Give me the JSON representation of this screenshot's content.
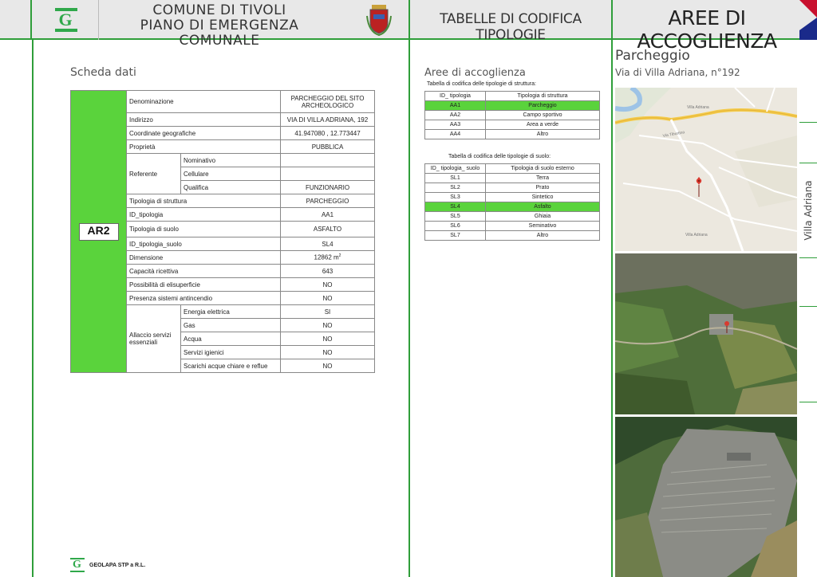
{
  "header": {
    "title_line1": "Comune di Tivoli",
    "title_line2": "Piano di Emergenza Comunale",
    "tab": "Tabelle di codifica tipologie",
    "section": "AREE DI ACCOGLIENZA"
  },
  "left": {
    "sheet_title": "Scheda dati",
    "code": "AR2",
    "rows": {
      "denominazione_label": "Denominazione",
      "denominazione_value": "PARCHEGGIO DEL SITO ARCHEOLOGICO",
      "indirizzo_label": "Indirizzo",
      "indirizzo_value": "VIA DI VILLA ADRIANA, 192",
      "coord_label": "Coordinate geografiche",
      "coord_value": "41.947080 , 12.773447",
      "proprieta_label": "Proprietà",
      "proprieta_value": "PUBBLICA",
      "referente_label": "Referente",
      "nominativo_label": "Nominativo",
      "nominativo_value": "",
      "cellulare_label": "Cellulare",
      "cellulare_value": "",
      "qualifica_label": "Qualifica",
      "qualifica_value": "FUNZIONARIO",
      "tip_strutt_label": "Tipologia di struttura",
      "tip_strutt_value": "PARCHEGGIO",
      "id_tip_label": "ID_tipologia",
      "id_tip_value": "AA1",
      "tip_suolo_label": "Tipologia di suolo",
      "tip_suolo_value": "ASFALTO",
      "id_tip_suolo_label": "ID_tipologia_suolo",
      "id_tip_suolo_value": "SL4",
      "dimensione_label": "Dimensione",
      "dimensione_value": "12862 m",
      "dimensione_unit_sup": "2",
      "capacita_label": "Capacità ricettiva",
      "capacita_value": "643",
      "elisuperficie_label": "Possibilità di elisuperficie",
      "elisuperficie_value": "NO",
      "antincendio_label": "Presenza sistemi antincendio",
      "antincendio_value": "NO",
      "allaccio_label": "Allaccio servizi essenziali",
      "energia_label": "Energia elettrica",
      "energia_value": "SI",
      "gas_label": "Gas",
      "gas_value": "NO",
      "acqua_label": "Acqua",
      "acqua_value": "NO",
      "igienici_label": "Servizi igienici",
      "igienici_value": "NO",
      "scarichi_label": "Scarichi acque chiare e reflue",
      "scarichi_value": "NO"
    },
    "footer": "GEOLAPA STP  a R.L."
  },
  "middle": {
    "title": "Aree di accoglienza",
    "struttura_caption": "Tabella di codifica delle tipologie di struttura:",
    "struttura_headers": [
      "ID_ tipologia",
      "Tipologia di struttura"
    ],
    "struttura_rows": [
      [
        "AA1",
        "Parcheggio"
      ],
      [
        "AA2",
        "Campo sportivo"
      ],
      [
        "AA3",
        "Area a verde"
      ],
      [
        "AA4",
        "Altro"
      ]
    ],
    "suolo_caption": "Tabella di codifica delle tipologie di suolo:",
    "suolo_headers": [
      "ID_ tipologia_ suolo",
      "Tipologia di suolo esterno"
    ],
    "suolo_rows": [
      [
        "SL1",
        "Terra"
      ],
      [
        "SL2",
        "Prato"
      ],
      [
        "SL3",
        "Sintetico"
      ],
      [
        "SL4",
        "Asfalto"
      ],
      [
        "SL5",
        "Ghiaia"
      ],
      [
        "SL6",
        "Seminativo"
      ],
      [
        "SL7",
        "Altro"
      ]
    ]
  },
  "right": {
    "place": "Parcheggio",
    "address": "Via di Villa Adriana, n°192",
    "side_label": "Villa Adriana",
    "map_label_1": "Villa Adriana",
    "map_label_2": "Villa Adriana",
    "map_label_3": "Via Tiburtina"
  },
  "colors": {
    "accent_green": "#2f9e3a",
    "highlight_green": "#5ad33c"
  }
}
